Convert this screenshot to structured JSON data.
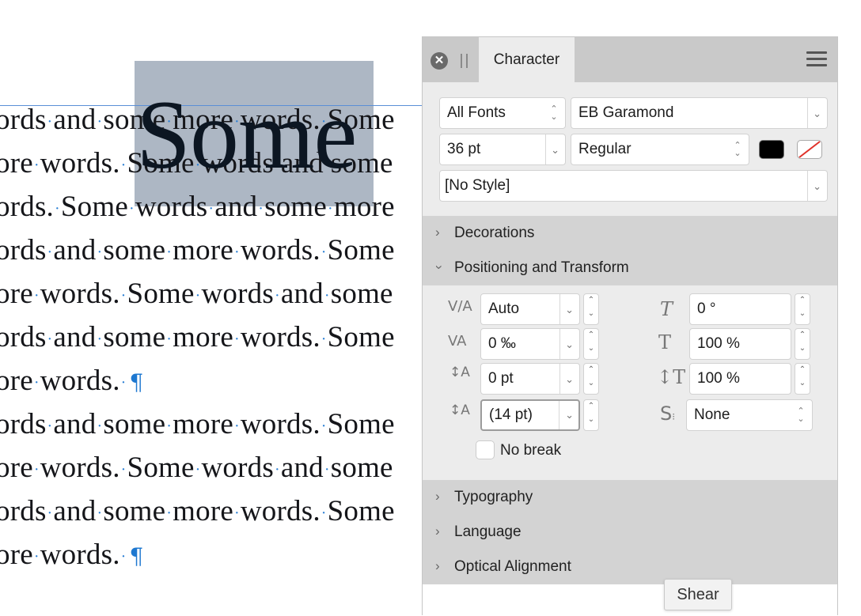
{
  "document": {
    "lines": [
      "ords·and·some·more·words.·Some",
      "ore·words.·Some·words·and·some",
      "ords.·Some·words·and·some·more",
      "ords·and·some·more·words.·Some",
      "ore·words.·Some·words·and·some",
      "ords·and·some·more·words.·Some",
      "ore·words.·¶",
      "ords·and·some·more·words.·Some",
      "ore·words.·Some·words·and·some",
      "ords·and·some·more·words.·Some",
      "ore·words.·¶"
    ],
    "selected_word": "Some",
    "selection_color": "#adb7c4",
    "pilcrow": "¶"
  },
  "panel": {
    "tab_title": "Character",
    "icons": {
      "close": "close-circle-icon",
      "grip": "grip-icon",
      "menu": "hamburger-menu-icon"
    },
    "font_collection": "All Fonts",
    "font_family": "EB Garamond",
    "font_size": "36 pt",
    "font_style": "Regular",
    "text_fill_color": "#000000",
    "paragraph_style": "[No Style]",
    "sections": {
      "decorations": "Decorations",
      "positioning": "Positioning and Transform",
      "typography": "Typography",
      "language": "Language",
      "optical": "Optical Alignment"
    },
    "positioning": {
      "kerning": "Auto",
      "tracking": "0 ‰",
      "baseline_shift": "0 pt",
      "leading": "(14 pt)",
      "shear": "0 °",
      "vertical_scale": "100 %",
      "horizontal_scale": "100 %",
      "superscript": "None",
      "no_break_label": "No break"
    },
    "icon_glyphs": {
      "kerning": "V/A",
      "tracking": "VA",
      "baseline": "A",
      "leading": "A",
      "shear": "T",
      "vscale": "T",
      "hscale": "T",
      "superscript": "S"
    }
  },
  "tooltip": {
    "text": "Shear"
  }
}
